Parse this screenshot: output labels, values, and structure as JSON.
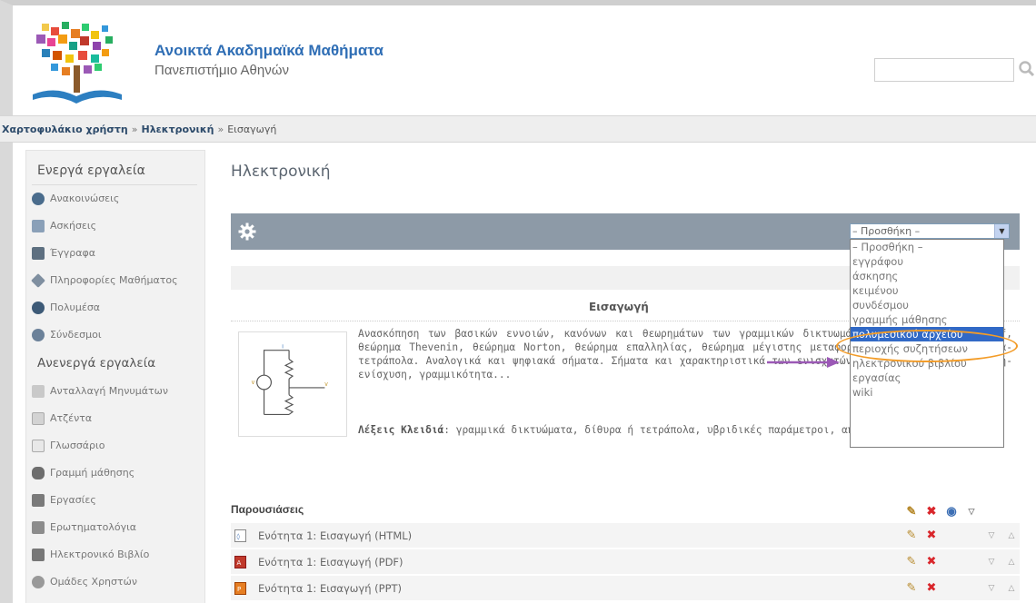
{
  "header": {
    "site_title": "Ανοικτά Ακαδημαϊκά Μαθήματα",
    "site_subtitle": "Πανεπιστήμιο Αθηνών",
    "search_placeholder": ""
  },
  "breadcrumb": {
    "items": [
      "Χαρτοφυλάκιο χρήστη",
      "Ηλεκτρονική",
      "Εισαγωγή"
    ]
  },
  "sidebar": {
    "active_heading": "Ενεργά εργαλεία",
    "active_items": [
      {
        "label": "Ανακοινώσεις",
        "icon": "announcements-icon"
      },
      {
        "label": "Ασκήσεις",
        "icon": "exercises-icon"
      },
      {
        "label": "Έγγραφα",
        "icon": "documents-icon"
      },
      {
        "label": "Πληροφορίες Μαθήματος",
        "icon": "course-info-icon"
      },
      {
        "label": "Πολυμέσα",
        "icon": "multimedia-icon"
      },
      {
        "label": "Σύνδεσμοι",
        "icon": "links-icon"
      }
    ],
    "inactive_heading": "Ανενεργά εργαλεία",
    "inactive_items": [
      {
        "label": "Ανταλλαγή Μηνυμάτων",
        "icon": "messages-icon"
      },
      {
        "label": "Ατζέντα",
        "icon": "agenda-icon"
      },
      {
        "label": "Γλωσσάριο",
        "icon": "glossary-icon"
      },
      {
        "label": "Γραμμή μάθησης",
        "icon": "learning-path-icon"
      },
      {
        "label": "Εργασίες",
        "icon": "assignments-icon"
      },
      {
        "label": "Ερωτηματολόγια",
        "icon": "questionnaires-icon"
      },
      {
        "label": "Ηλεκτρονικό Βιβλίο",
        "icon": "ebook-icon"
      },
      {
        "label": "Ομάδες Χρηστών",
        "icon": "user-groups-icon"
      }
    ]
  },
  "main": {
    "course_title": "Ηλεκτρονική",
    "add_select": {
      "selected": "– Προσθήκη –",
      "options": [
        "– Προσθήκη –",
        "εγγράφου",
        "άσκησης",
        "κειμένου",
        "συνδέσμου",
        "γραμμής μάθησης",
        "πολυμεσικού αρχείου",
        "περιοχής συζητήσεων",
        "ηλεκτρονικού βιβλίου",
        "εργασίας",
        "wiki"
      ],
      "highlighted_index": 6
    },
    "section_title": "Εισαγωγή",
    "description": "Ανασκόπηση των βασικών εννοιών, κανόνων και θεωρημάτων των γραμμικών δικτυωμάτων: Νόμοι του Kirchhoff, θεώρημα Thevenin, θεώρημα Norton, θεώρημα επαλληλίας, θεώρημα μέγιστης μεταφοράς ισχύος, βασικά δίθυρα-τετράπολα. Αναλογικά και ψηφιακά σήματα. Σήματα και χαρακτηριστικά των ενισχυτών (απόδοση ισχύος, απολαβή-ενίσχυση, γραμμικότητα...",
    "keywords_label": "Λέξεις Κλειδιά",
    "keywords": ": γραμμικά δικτυώματα, δίθυρα ή τετράπολα, υβριδικές παράμετροι, απολαβή ή ενίσχυση",
    "resources_heading": "Παρουσιάσεις",
    "resources": [
      {
        "label": "Ενότητα 1: Εισαγωγή (HTML)",
        "icon": "html-file-icon"
      },
      {
        "label": "Ενότητα 1: Εισαγωγή (PDF)",
        "icon": "pdf-file-icon"
      },
      {
        "label": "Ενότητα 1: Εισαγωγή (PPT)",
        "icon": "ppt-file-icon"
      }
    ]
  },
  "colors": {
    "title_blue": "#2f6eb5",
    "toolbar": "#8d9aa7",
    "selected_option": "#3169c6",
    "highlight": "#f39c28",
    "pointer_arrow": "#9b59b6"
  }
}
